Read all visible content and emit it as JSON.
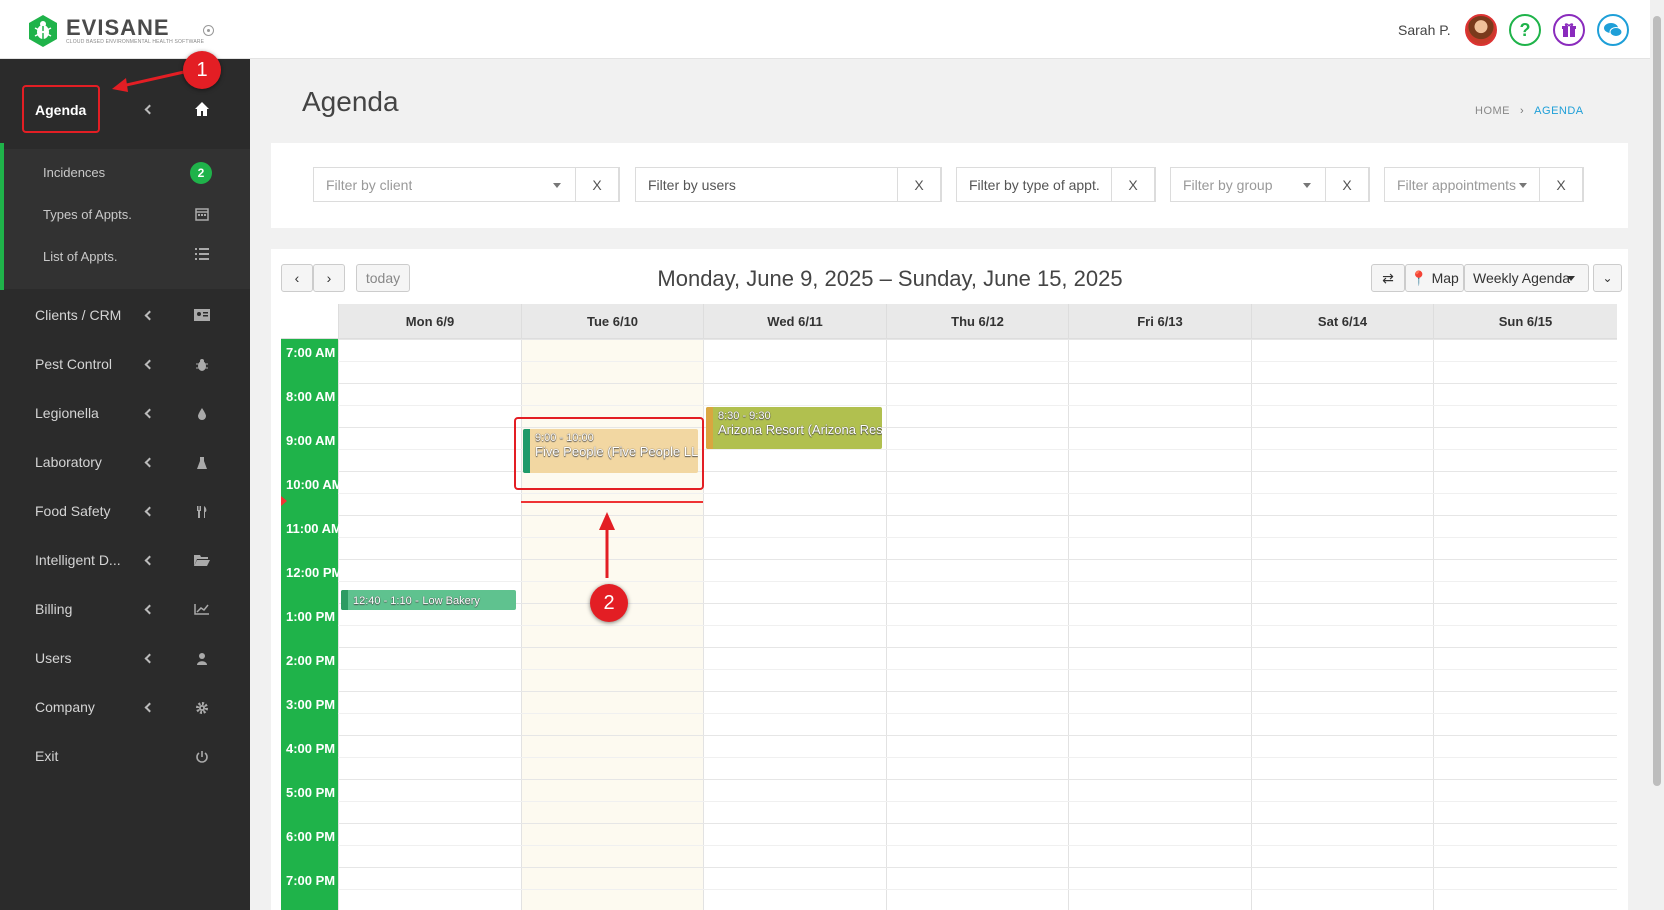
{
  "brand": {
    "name": "EVISANE",
    "tagline": "CLOUD BASED ENVIRONMENTAL HEALTH SOFTWARE"
  },
  "topbar": {
    "user_name": "Sarah P.",
    "help_glyph": "?"
  },
  "sidebar": {
    "active": {
      "label": "Agenda"
    },
    "subitems": [
      {
        "label": "Incidences",
        "badge": "2"
      },
      {
        "label": "Types of Appts.",
        "icon": "calendar-icon"
      },
      {
        "label": "List of Appts.",
        "icon": "list-icon"
      }
    ],
    "items": [
      {
        "label": "Clients / CRM",
        "icon": "id-card-icon"
      },
      {
        "label": "Pest Control",
        "icon": "bug-icon"
      },
      {
        "label": "Legionella",
        "icon": "drop-icon"
      },
      {
        "label": "Laboratory",
        "icon": "flask-icon"
      },
      {
        "label": "Food Safety",
        "icon": "cutlery-icon"
      },
      {
        "label": "Intelligent D...",
        "icon": "folder-icon"
      },
      {
        "label": "Billing",
        "icon": "chart-icon"
      },
      {
        "label": "Users",
        "icon": "user-icon"
      },
      {
        "label": "Company",
        "icon": "gear-icon"
      },
      {
        "label": "Exit",
        "icon": "power-icon"
      }
    ]
  },
  "page": {
    "title": "Agenda",
    "breadcrumb": {
      "home": "HOME",
      "current": "AGENDA"
    }
  },
  "filters": [
    {
      "placeholder": "Filter by client",
      "clear": "X"
    },
    {
      "placeholder": "Filter by users",
      "clear": "X"
    },
    {
      "placeholder": "Filter by type of appt.",
      "clear": "X"
    },
    {
      "placeholder": "Filter by group",
      "clear": "X"
    },
    {
      "placeholder": "Filter appointments",
      "clear": "X"
    }
  ],
  "calendar": {
    "today_label": "today",
    "range_title": "Monday, June 9, 2025 – Sunday, June 15, 2025",
    "map_label": "Map",
    "view_label": "Weekly Agenda",
    "days": [
      "Mon 6/9",
      "Tue 6/10",
      "Wed 6/11",
      "Thu 6/12",
      "Fri 6/13",
      "Sat 6/14",
      "Sun 6/15"
    ],
    "hours": [
      "7:00 AM",
      "8:00 AM",
      "9:00 AM",
      "10:00 AM",
      "11:00 AM",
      "12:00 PM",
      "1:00 PM",
      "2:00 PM",
      "3:00 PM",
      "4:00 PM",
      "5:00 PM",
      "6:00 PM",
      "7:00 PM"
    ],
    "events": [
      {
        "time": "9:00 - 10:00",
        "title": "Five People (Five People LLC)",
        "day": "Tue 6/10",
        "color": "#f2d7a2",
        "bar": "#1e9a6a"
      },
      {
        "time": "8:30 - 9:30",
        "title": "Arizona Resort (Arizona Resort)",
        "day": "Wed 6/11",
        "color": "#b1c04f",
        "bar": "#d9a640"
      },
      {
        "time": "12:40 - 1:10",
        "title": "Low Bakery",
        "day": "Mon 6/9",
        "color": "#5fc28f",
        "bar": "#2d9b63"
      }
    ]
  },
  "annotations": [
    "1",
    "2"
  ],
  "colors": {
    "accent_green": "#1fb34a",
    "sidebar_bg": "#2b2b2b",
    "annotation_red": "#e31e24",
    "link_blue": "#1e9fd8"
  }
}
